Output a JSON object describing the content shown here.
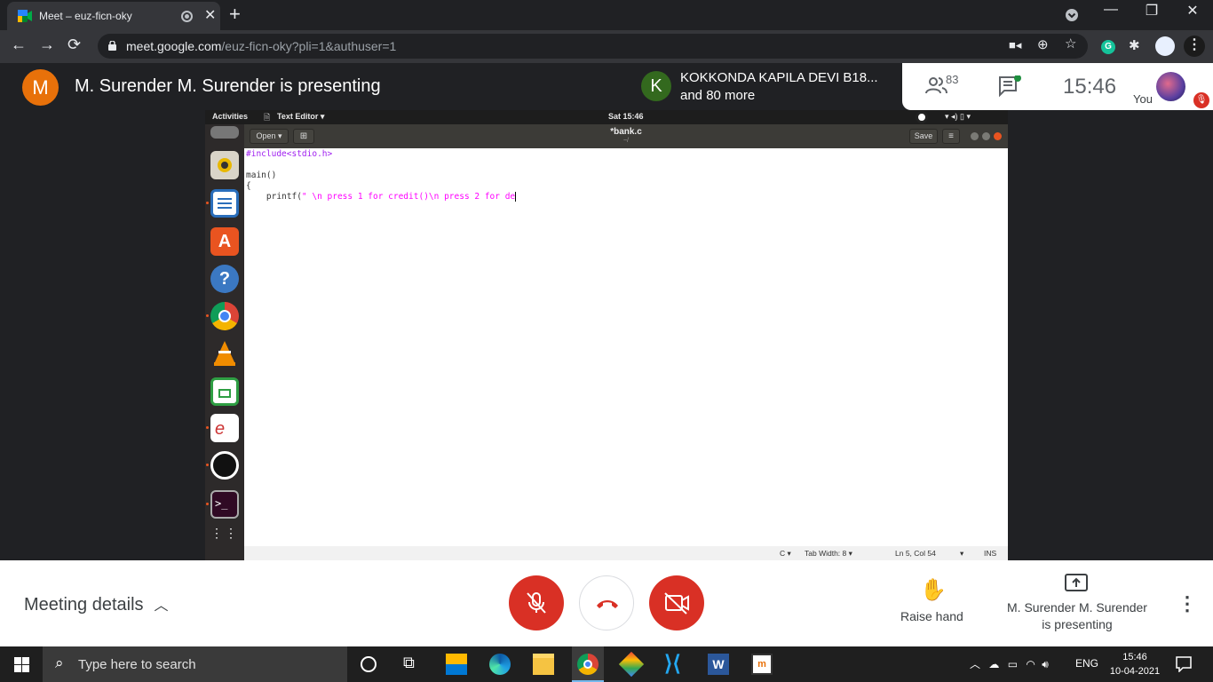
{
  "browser": {
    "tab_title": "Meet – euz-ficn-oky",
    "tab_close": "✕",
    "new_tab": "+",
    "url_host": "meet.google.com",
    "url_path": "/euz-ficn-oky?pli=1&authuser=1",
    "profile_initial": "G"
  },
  "meet": {
    "presenter_initial": "M",
    "presenting_text": "M. Surender M. Surender is presenting",
    "participant_initial": "K",
    "participant_name": "KOKKONDA KAPILA DEVI B18...",
    "participant_more": "and 80 more",
    "participant_count": "83",
    "clock": "15:46",
    "self_label": "You"
  },
  "ubuntu": {
    "activities": "Activities",
    "app_menu": "Text Editor ▾",
    "datetime": "Sat 15:46",
    "open_button": "Open ▾",
    "file_title": "*bank.c",
    "file_subtitle": "~/",
    "save_button": "Save",
    "code_line1": "#include<stdio.h>",
    "code_line3": "main()",
    "code_line4": "{",
    "code_line5_pre": "    printf(",
    "code_line5_str": "\" \\n press 1 for credit()\\n press 2 for de",
    "status_lang": "C ▾",
    "status_tab": "Tab Width: 8 ▾",
    "status_pos": "Ln 5, Col 54",
    "status_mode": "INS"
  },
  "controls": {
    "meeting_details": "Meeting details",
    "raise_hand": "Raise hand",
    "presenting_line1": "M. Surender M. Surender",
    "presenting_line2": "is presenting"
  },
  "taskbar": {
    "search_placeholder": "Type here to search",
    "language": "ENG",
    "time": "15:46",
    "date": "10-04-2021"
  },
  "colors": {
    "meet_red": "#d93025",
    "presenter_orange": "#e8710a",
    "participant_green": "#33691e",
    "ubuntu_orange": "#e95420"
  }
}
